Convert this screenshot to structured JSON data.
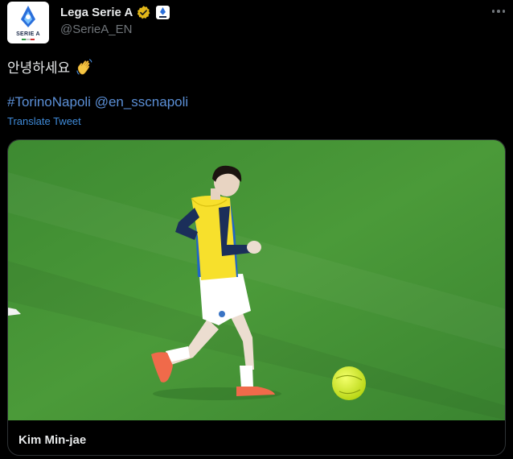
{
  "account": {
    "display_name": "Lega Serie A",
    "handle": "@SerieA_EN",
    "avatar_text": "SERIE A",
    "avatar_icon": "serie-a-logo",
    "verified_icon": "gold-verified-badge",
    "affiliate_icon": "serie-a-affiliate-badge"
  },
  "tweet": {
    "text": "안녕하세요",
    "emoji_icon": "waving-hand-icon",
    "hashtag": "#TorinoNapoli",
    "mention": "@en_sscnapoli",
    "translate_label": "Translate Tweet"
  },
  "media": {
    "caption": "Kim Min-jae",
    "image_icon": "player-warmup-photo"
  },
  "colors": {
    "background": "#000000",
    "text": "#e7e9ea",
    "muted": "#71767b",
    "link": "#5b8fd6",
    "verified_gold": "#e2b719",
    "pitch": "#3f8a33"
  }
}
